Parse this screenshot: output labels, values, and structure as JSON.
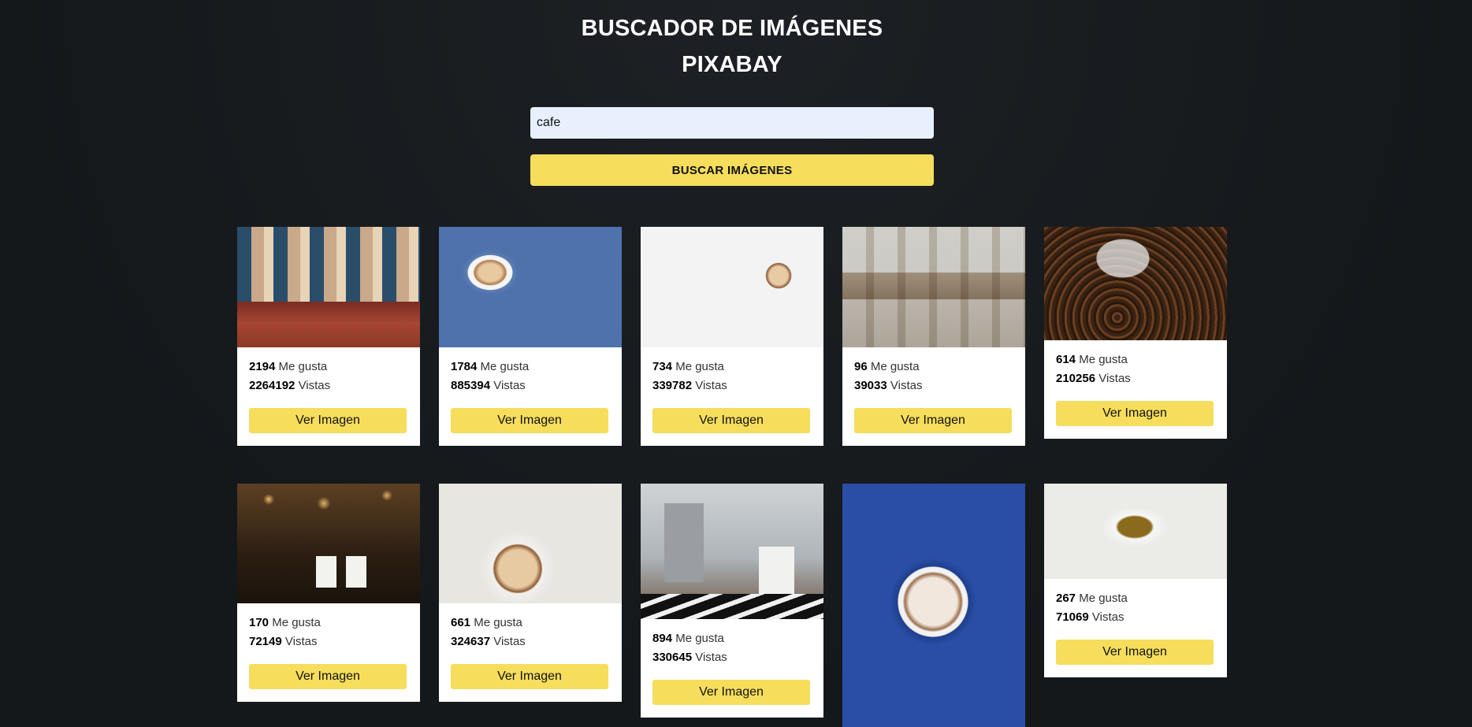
{
  "header": {
    "title_line1": "BUSCADOR DE IMÁGENES",
    "title_line2": "PIXABAY"
  },
  "search": {
    "value": "cafe",
    "button_label": "BUSCAR IMÁGENES"
  },
  "labels": {
    "likes": "Me gusta",
    "views": "Vistas",
    "view_button": "Ver Imagen"
  },
  "results": [
    {
      "likes": "2194",
      "views": "2264192"
    },
    {
      "likes": "1784",
      "views": "885394"
    },
    {
      "likes": "734",
      "views": "339782"
    },
    {
      "likes": "96",
      "views": "39033"
    },
    {
      "likes": "614",
      "views": "210256"
    },
    {
      "likes": "170",
      "views": "72149"
    },
    {
      "likes": "661",
      "views": "324637"
    },
    {
      "likes": "894",
      "views": "330645"
    },
    {
      "likes": null,
      "views": null
    },
    {
      "likes": "267",
      "views": "71069"
    }
  ]
}
